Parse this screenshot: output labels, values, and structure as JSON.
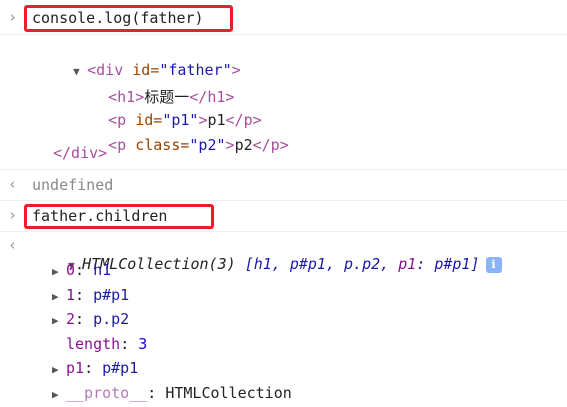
{
  "console": {
    "cmd1": "console.log(father)",
    "father_open": [
      "<div",
      " id=",
      "\"father\"",
      ">"
    ],
    "h1_line": [
      "<h1>",
      "标题一",
      "</h1>"
    ],
    "p1_line": [
      "<p",
      " id=",
      "\"p1\"",
      ">",
      "p1",
      "</p>"
    ],
    "p2_line": [
      "<p",
      " class=",
      "\"p2\"",
      ">",
      "p2",
      "</p>"
    ],
    "father_close": "</div>",
    "result1": "undefined",
    "cmd2": "father.children",
    "collection_head": "HTMLCollection(3)",
    "collection_preview": [
      {
        "text": "[h1, ",
        "cls": "val"
      },
      {
        "text": "p#p1",
        "cls": "val"
      },
      {
        "text": ", ",
        "cls": "val"
      },
      {
        "text": "p.p2",
        "cls": "val"
      },
      {
        "text": ", ",
        "cls": "val"
      },
      {
        "text": "p1",
        "cls": "key"
      },
      {
        "text": ": ",
        "cls": "val"
      },
      {
        "text": "p#p1",
        "cls": "val"
      },
      {
        "text": "]",
        "cls": "val"
      }
    ],
    "info_icon": "i",
    "items": [
      {
        "key": "0",
        "value": "h1",
        "expandable": true
      },
      {
        "key": "1",
        "value": "p#p1",
        "expandable": true
      },
      {
        "key": "2",
        "value": "p.p2",
        "expandable": true
      },
      {
        "key": "length",
        "value": "3",
        "expandable": false
      },
      {
        "key": "p1",
        "value": "p#p1",
        "expandable": true
      },
      {
        "key": "__proto__",
        "value": "HTMLCollection",
        "expandable": true
      }
    ],
    "prompt_glyph": "›",
    "result_glyph": "‹"
  },
  "colors": {
    "highlight_border": "#e8202a"
  }
}
